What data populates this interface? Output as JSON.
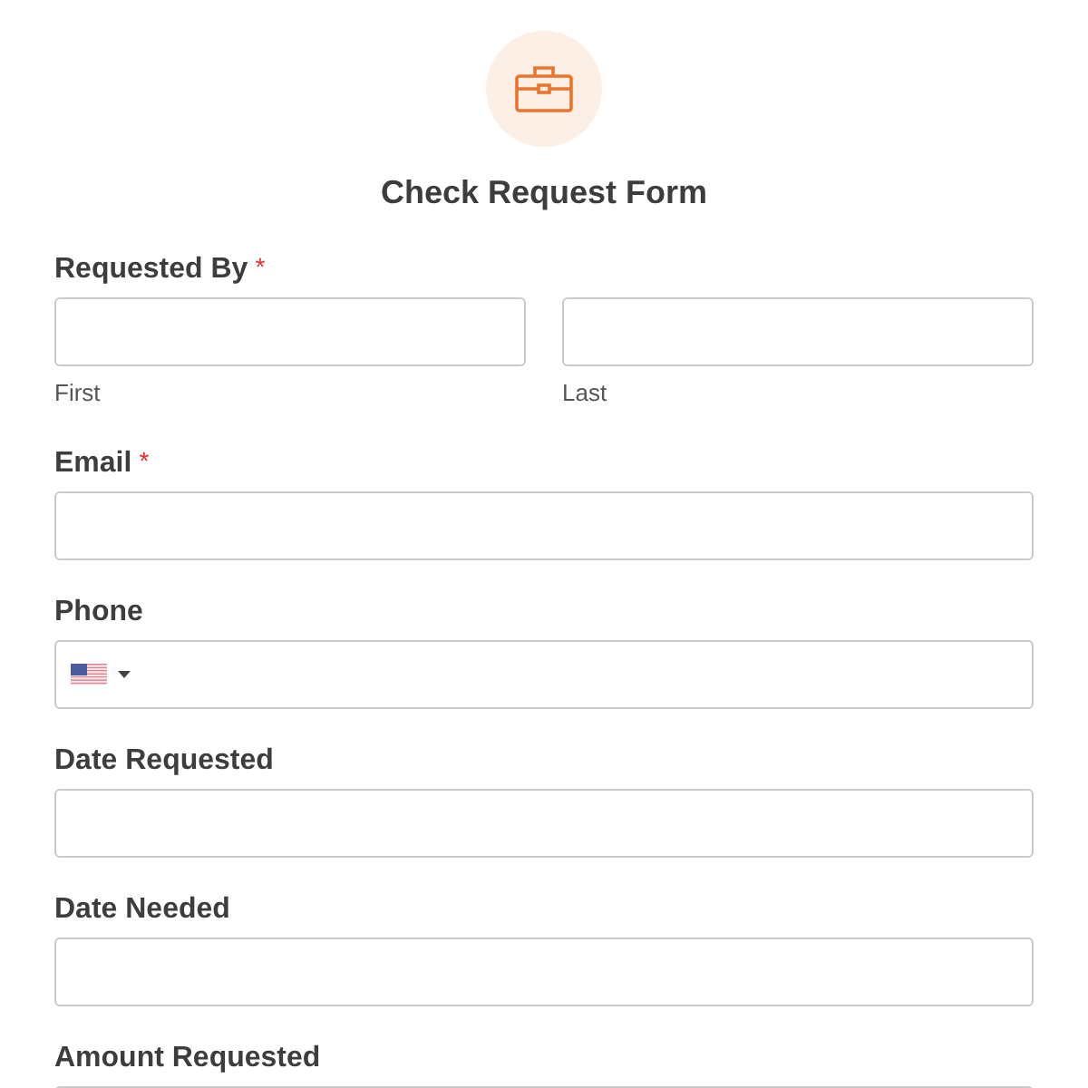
{
  "form": {
    "title": "Check Request Form",
    "required_mark": "*",
    "fields": [
      {
        "kind": "name",
        "label": "Requested By",
        "required": true,
        "sublabels": [
          "First",
          "Last"
        ]
      },
      {
        "kind": "text",
        "label": "Email",
        "required": true
      },
      {
        "kind": "phone",
        "label": "Phone",
        "required": false
      },
      {
        "kind": "text",
        "label": "Date Requested",
        "required": false
      },
      {
        "kind": "text",
        "label": "Date Needed",
        "required": false
      },
      {
        "kind": "text",
        "label": "Amount Requested",
        "required": false
      }
    ]
  }
}
